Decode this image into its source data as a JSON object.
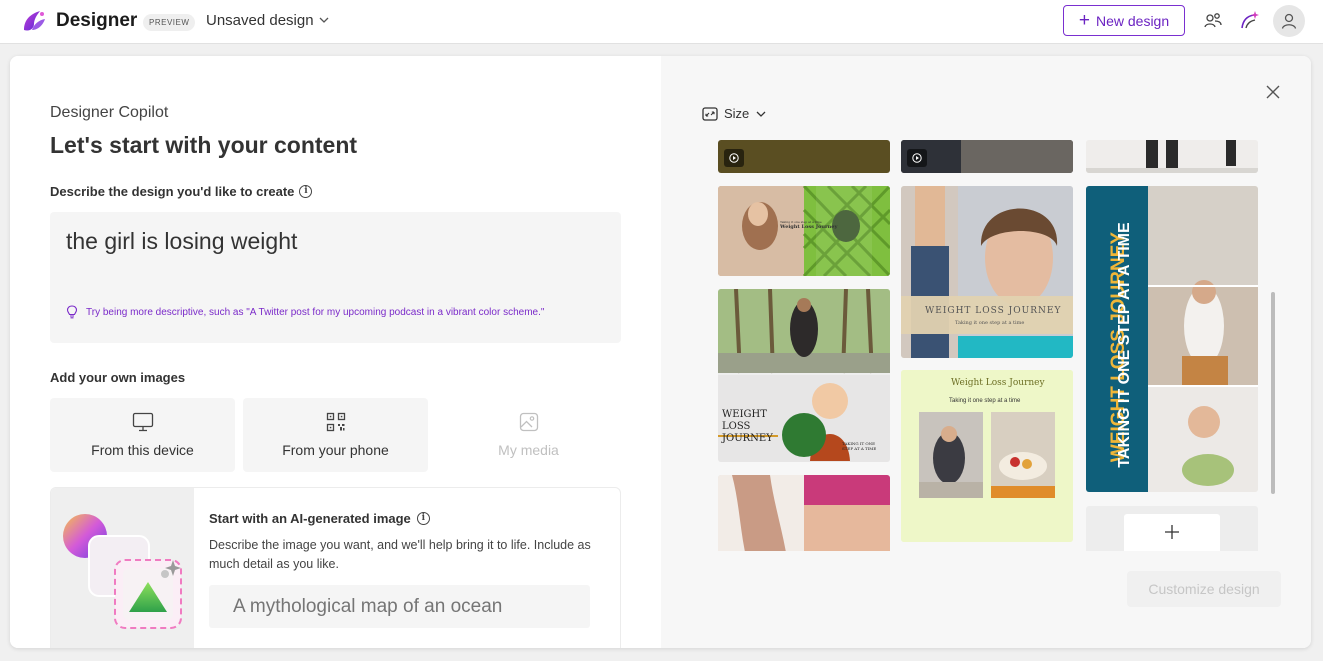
{
  "header": {
    "app_name": "Designer",
    "badge": "PREVIEW",
    "document_title": "Unsaved design",
    "new_design_label": "New design"
  },
  "left_panel": {
    "copilot_label": "Designer Copilot",
    "heading": "Let's start with your content",
    "describe_label": "Describe the design you'd like to create",
    "prompt_value": "the girl is losing weight",
    "tip": "Try being more descriptive, such as \"A Twitter post for my upcoming podcast in a vibrant color scheme.\"",
    "add_images_label": "Add your own images",
    "sources": [
      {
        "label": "From this device",
        "icon": "monitor-icon"
      },
      {
        "label": "From your phone",
        "icon": "qr-code-icon"
      },
      {
        "label": "My media",
        "icon": "image-icon"
      }
    ],
    "ai_card": {
      "title": "Start with an AI-generated image",
      "description": "Describe the image you want, and we'll help bring it to life. Include as much detail as you like.",
      "placeholder": "A mythological map of an ocean"
    }
  },
  "right_panel": {
    "size_label": "Size",
    "customize_label": "Customize design",
    "tiles": [
      {
        "title": "Weight Loss Journey",
        "subtitle": "Taking it one step at a time"
      },
      {
        "title": "WEIGHT LOSS JOURNEY",
        "subtitle": "Taking it one step at a time"
      },
      {
        "title": "WEIGHT LOSS JOURNEY",
        "subtitle": "TAKING IT ONE STEP AT A TIME"
      },
      {
        "title": "WEIGHT LOSS JOURNEY",
        "subtitle": "Taking it one step at a time"
      },
      {
        "title": "WEIGHT LOSS JOURNEY",
        "subtitle": "TAKING IT ONE STEP AT A TIME"
      }
    ]
  }
}
